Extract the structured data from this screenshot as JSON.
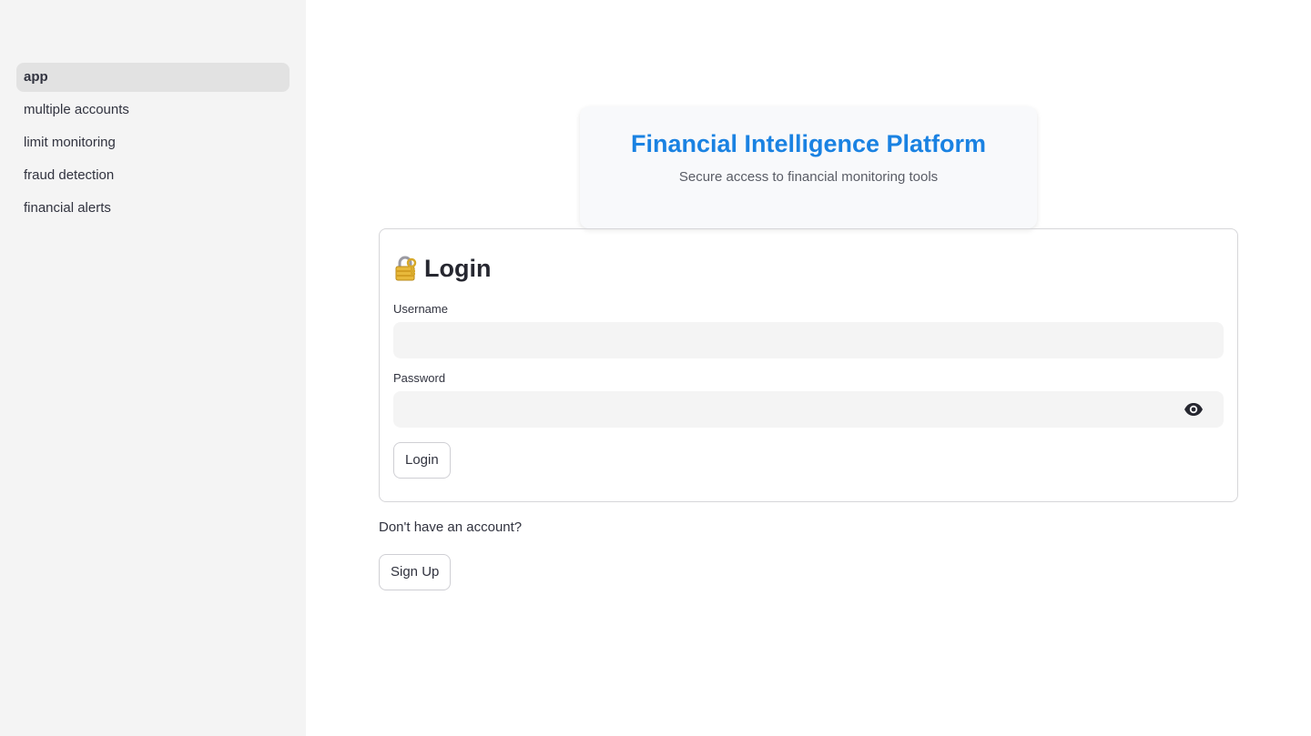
{
  "sidebar": {
    "items": [
      {
        "label": "app",
        "active": true
      },
      {
        "label": "multiple accounts"
      },
      {
        "label": "limit monitoring"
      },
      {
        "label": "fraud detection"
      },
      {
        "label": "financial alerts"
      }
    ]
  },
  "header": {
    "title": "Financial Intelligence Platform",
    "subtitle": "Secure access to financial monitoring tools",
    "title_color": "#1a82e2"
  },
  "login": {
    "heading": "Login",
    "heading_icon": "lock-with-key-icon",
    "username_label": "Username",
    "username_value": "",
    "password_label": "Password",
    "password_value": "",
    "password_toggle_icon": "eye-icon",
    "submit_label": "Login"
  },
  "signup": {
    "prompt": "Don't have an account?",
    "button_label": "Sign Up"
  }
}
